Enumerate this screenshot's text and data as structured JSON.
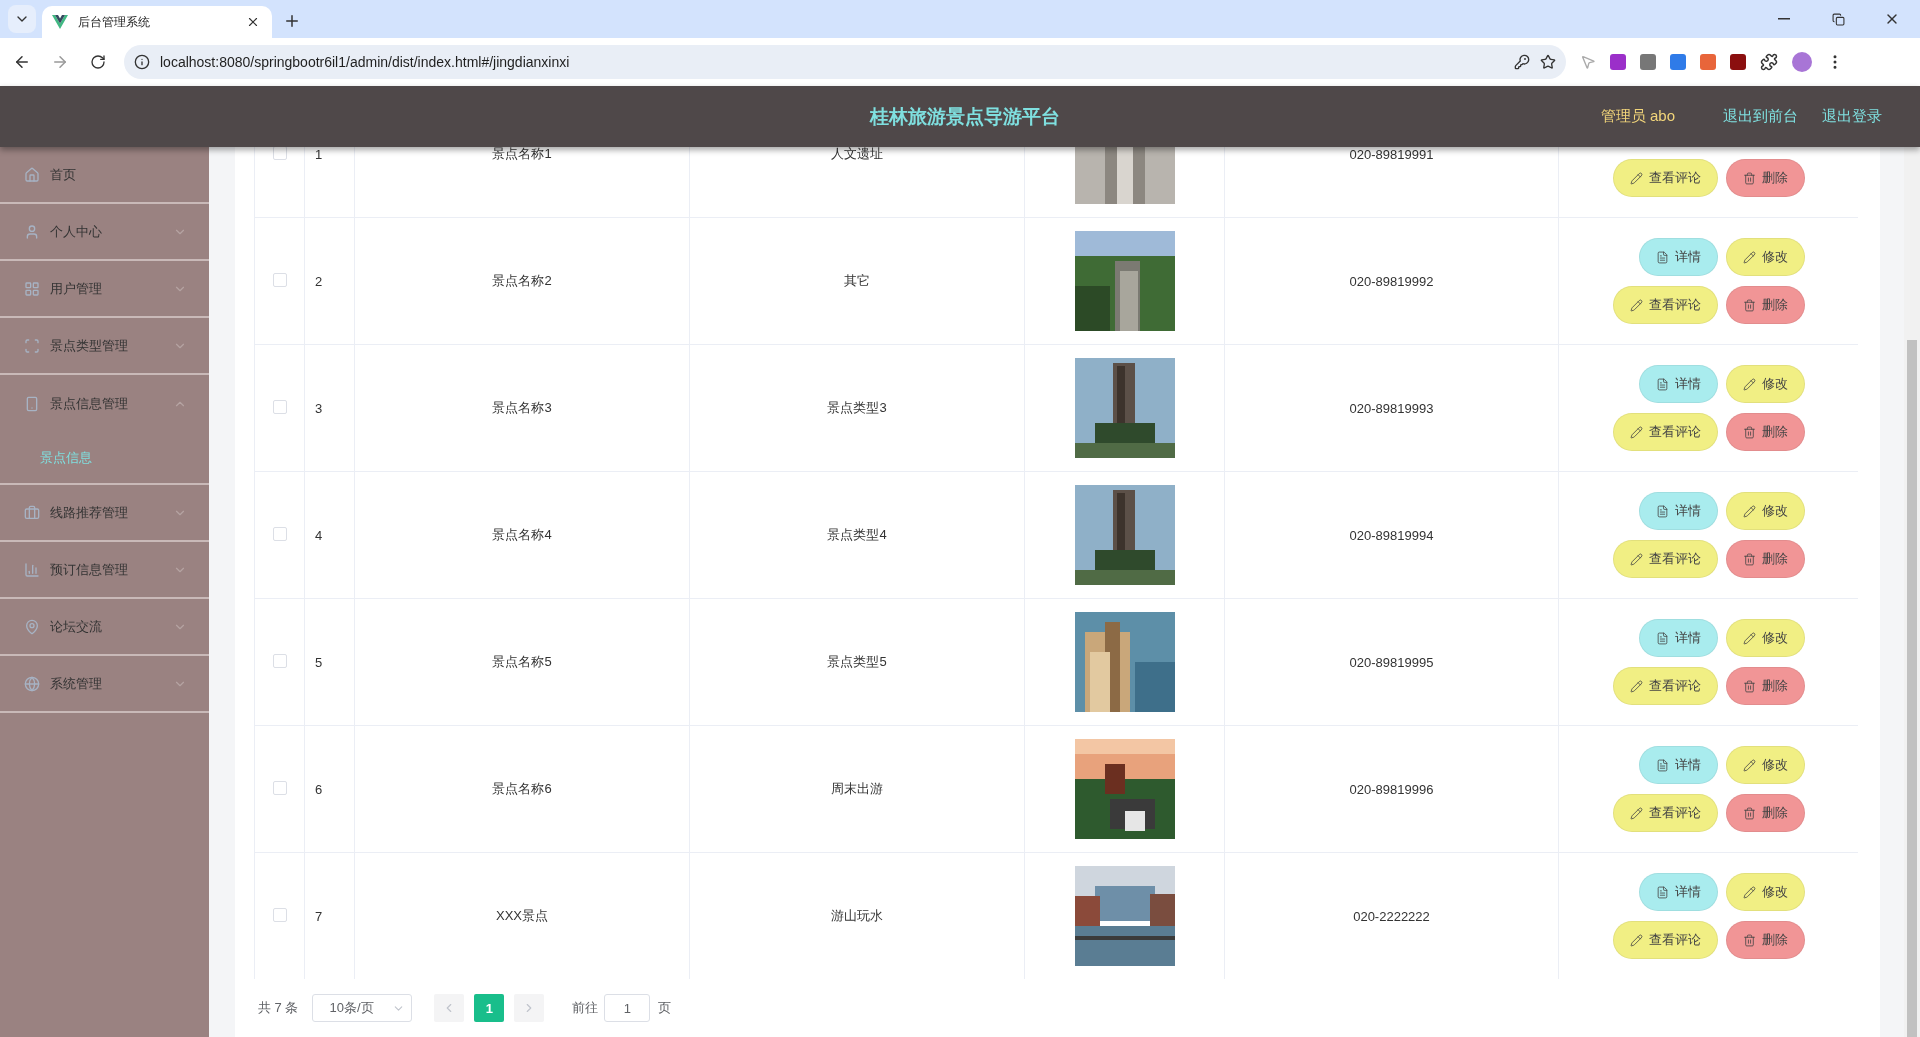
{
  "browser": {
    "tab_title": "后台管理系统",
    "url": "localhost:8080/springbootr6il1/admin/dist/index.html#/jingdianxinxi"
  },
  "header": {
    "title": "桂林旅游景点导游平台",
    "user": "管理员 abo",
    "links": [
      "退出到前台",
      "退出登录"
    ]
  },
  "sidebar": {
    "items": [
      {
        "label": "首页",
        "selected": false
      },
      {
        "label": "个人中心",
        "selected": false,
        "expanded": false
      },
      {
        "label": "用户管理",
        "selected": false,
        "expanded": false
      },
      {
        "label": "景点类型管理",
        "selected": false,
        "expanded": false
      },
      {
        "label": "景点信息管理",
        "selected": false,
        "expanded": true,
        "children": [
          {
            "label": "景点信息",
            "selected": true
          }
        ]
      },
      {
        "label": "线路推荐管理",
        "selected": false,
        "expanded": false
      },
      {
        "label": "预订信息管理",
        "selected": false,
        "expanded": false
      },
      {
        "label": "论坛交流",
        "selected": false,
        "expanded": false
      },
      {
        "label": "系统管理",
        "selected": false,
        "expanded": false
      }
    ]
  },
  "table": {
    "rows": [
      {
        "checked": false,
        "index": "1",
        "name": "景点名称1",
        "type": "人文遗址",
        "phone": "020-89819991",
        "actions": [
          {
            "kind": "comments",
            "label": "查看评论"
          },
          {
            "kind": "delete",
            "label": "删除"
          }
        ]
      },
      {
        "checked": false,
        "index": "2",
        "name": "景点名称2",
        "type": "其它",
        "phone": "020-89819992",
        "actions": [
          {
            "kind": "detail",
            "label": "详情"
          },
          {
            "kind": "edit",
            "label": "修改"
          },
          {
            "kind": "comments",
            "label": "查看评论"
          },
          {
            "kind": "delete",
            "label": "删除"
          }
        ]
      },
      {
        "checked": false,
        "index": "3",
        "name": "景点名称3",
        "type": "景点类型3",
        "phone": "020-89819993",
        "actions": [
          {
            "kind": "detail",
            "label": "详情"
          },
          {
            "kind": "edit",
            "label": "修改"
          },
          {
            "kind": "comments",
            "label": "查看评论"
          },
          {
            "kind": "delete",
            "label": "删除"
          }
        ]
      },
      {
        "checked": false,
        "index": "4",
        "name": "景点名称4",
        "type": "景点类型4",
        "phone": "020-89819994",
        "actions": [
          {
            "kind": "detail",
            "label": "详情"
          },
          {
            "kind": "edit",
            "label": "修改"
          },
          {
            "kind": "comments",
            "label": "查看评论"
          },
          {
            "kind": "delete",
            "label": "删除"
          }
        ]
      },
      {
        "checked": false,
        "index": "5",
        "name": "景点名称5",
        "type": "景点类型5",
        "phone": "020-89819995",
        "actions": [
          {
            "kind": "detail",
            "label": "详情"
          },
          {
            "kind": "edit",
            "label": "修改"
          },
          {
            "kind": "comments",
            "label": "查看评论"
          },
          {
            "kind": "delete",
            "label": "删除"
          }
        ]
      },
      {
        "checked": false,
        "index": "6",
        "name": "景点名称6",
        "type": "周末出游",
        "phone": "020-89819996",
        "actions": [
          {
            "kind": "detail",
            "label": "详情"
          },
          {
            "kind": "edit",
            "label": "修改"
          },
          {
            "kind": "comments",
            "label": "查看评论"
          },
          {
            "kind": "delete",
            "label": "删除"
          }
        ]
      },
      {
        "checked": false,
        "index": "7",
        "name": "XXX景点",
        "type": "游山玩水",
        "phone": "020-2222222",
        "actions": [
          {
            "kind": "detail",
            "label": "详情"
          },
          {
            "kind": "edit",
            "label": "修改"
          },
          {
            "kind": "comments",
            "label": "查看评论"
          },
          {
            "kind": "delete",
            "label": "删除"
          }
        ]
      }
    ]
  },
  "pagination": {
    "total": "共 7 条",
    "page_size": "10条/页",
    "pages": [
      {
        "label": "1",
        "selected": true
      }
    ],
    "goto_label": "前往",
    "goto_value": "1",
    "page_unit": "页"
  }
}
